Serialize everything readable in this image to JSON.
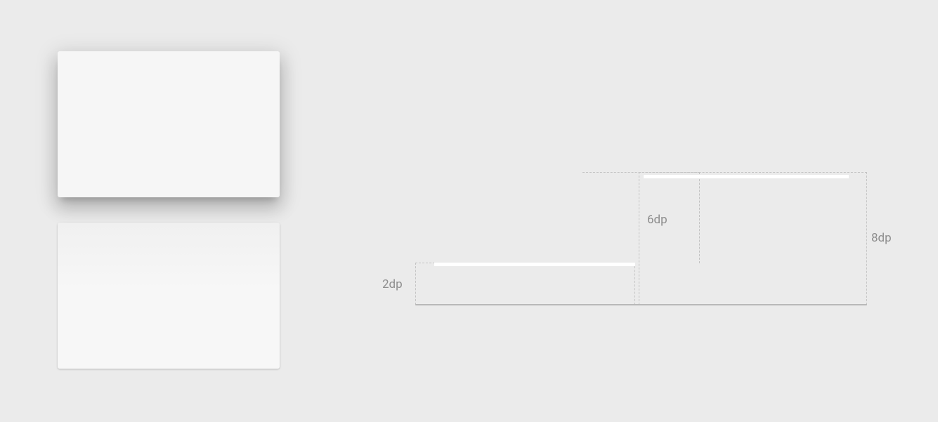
{
  "cards": {
    "top": {
      "elevation": "8dp"
    },
    "bottom": {
      "elevation": "2dp"
    }
  },
  "diagram": {
    "labels": {
      "two": "2dp",
      "six": "6dp",
      "eight": "8dp"
    }
  }
}
